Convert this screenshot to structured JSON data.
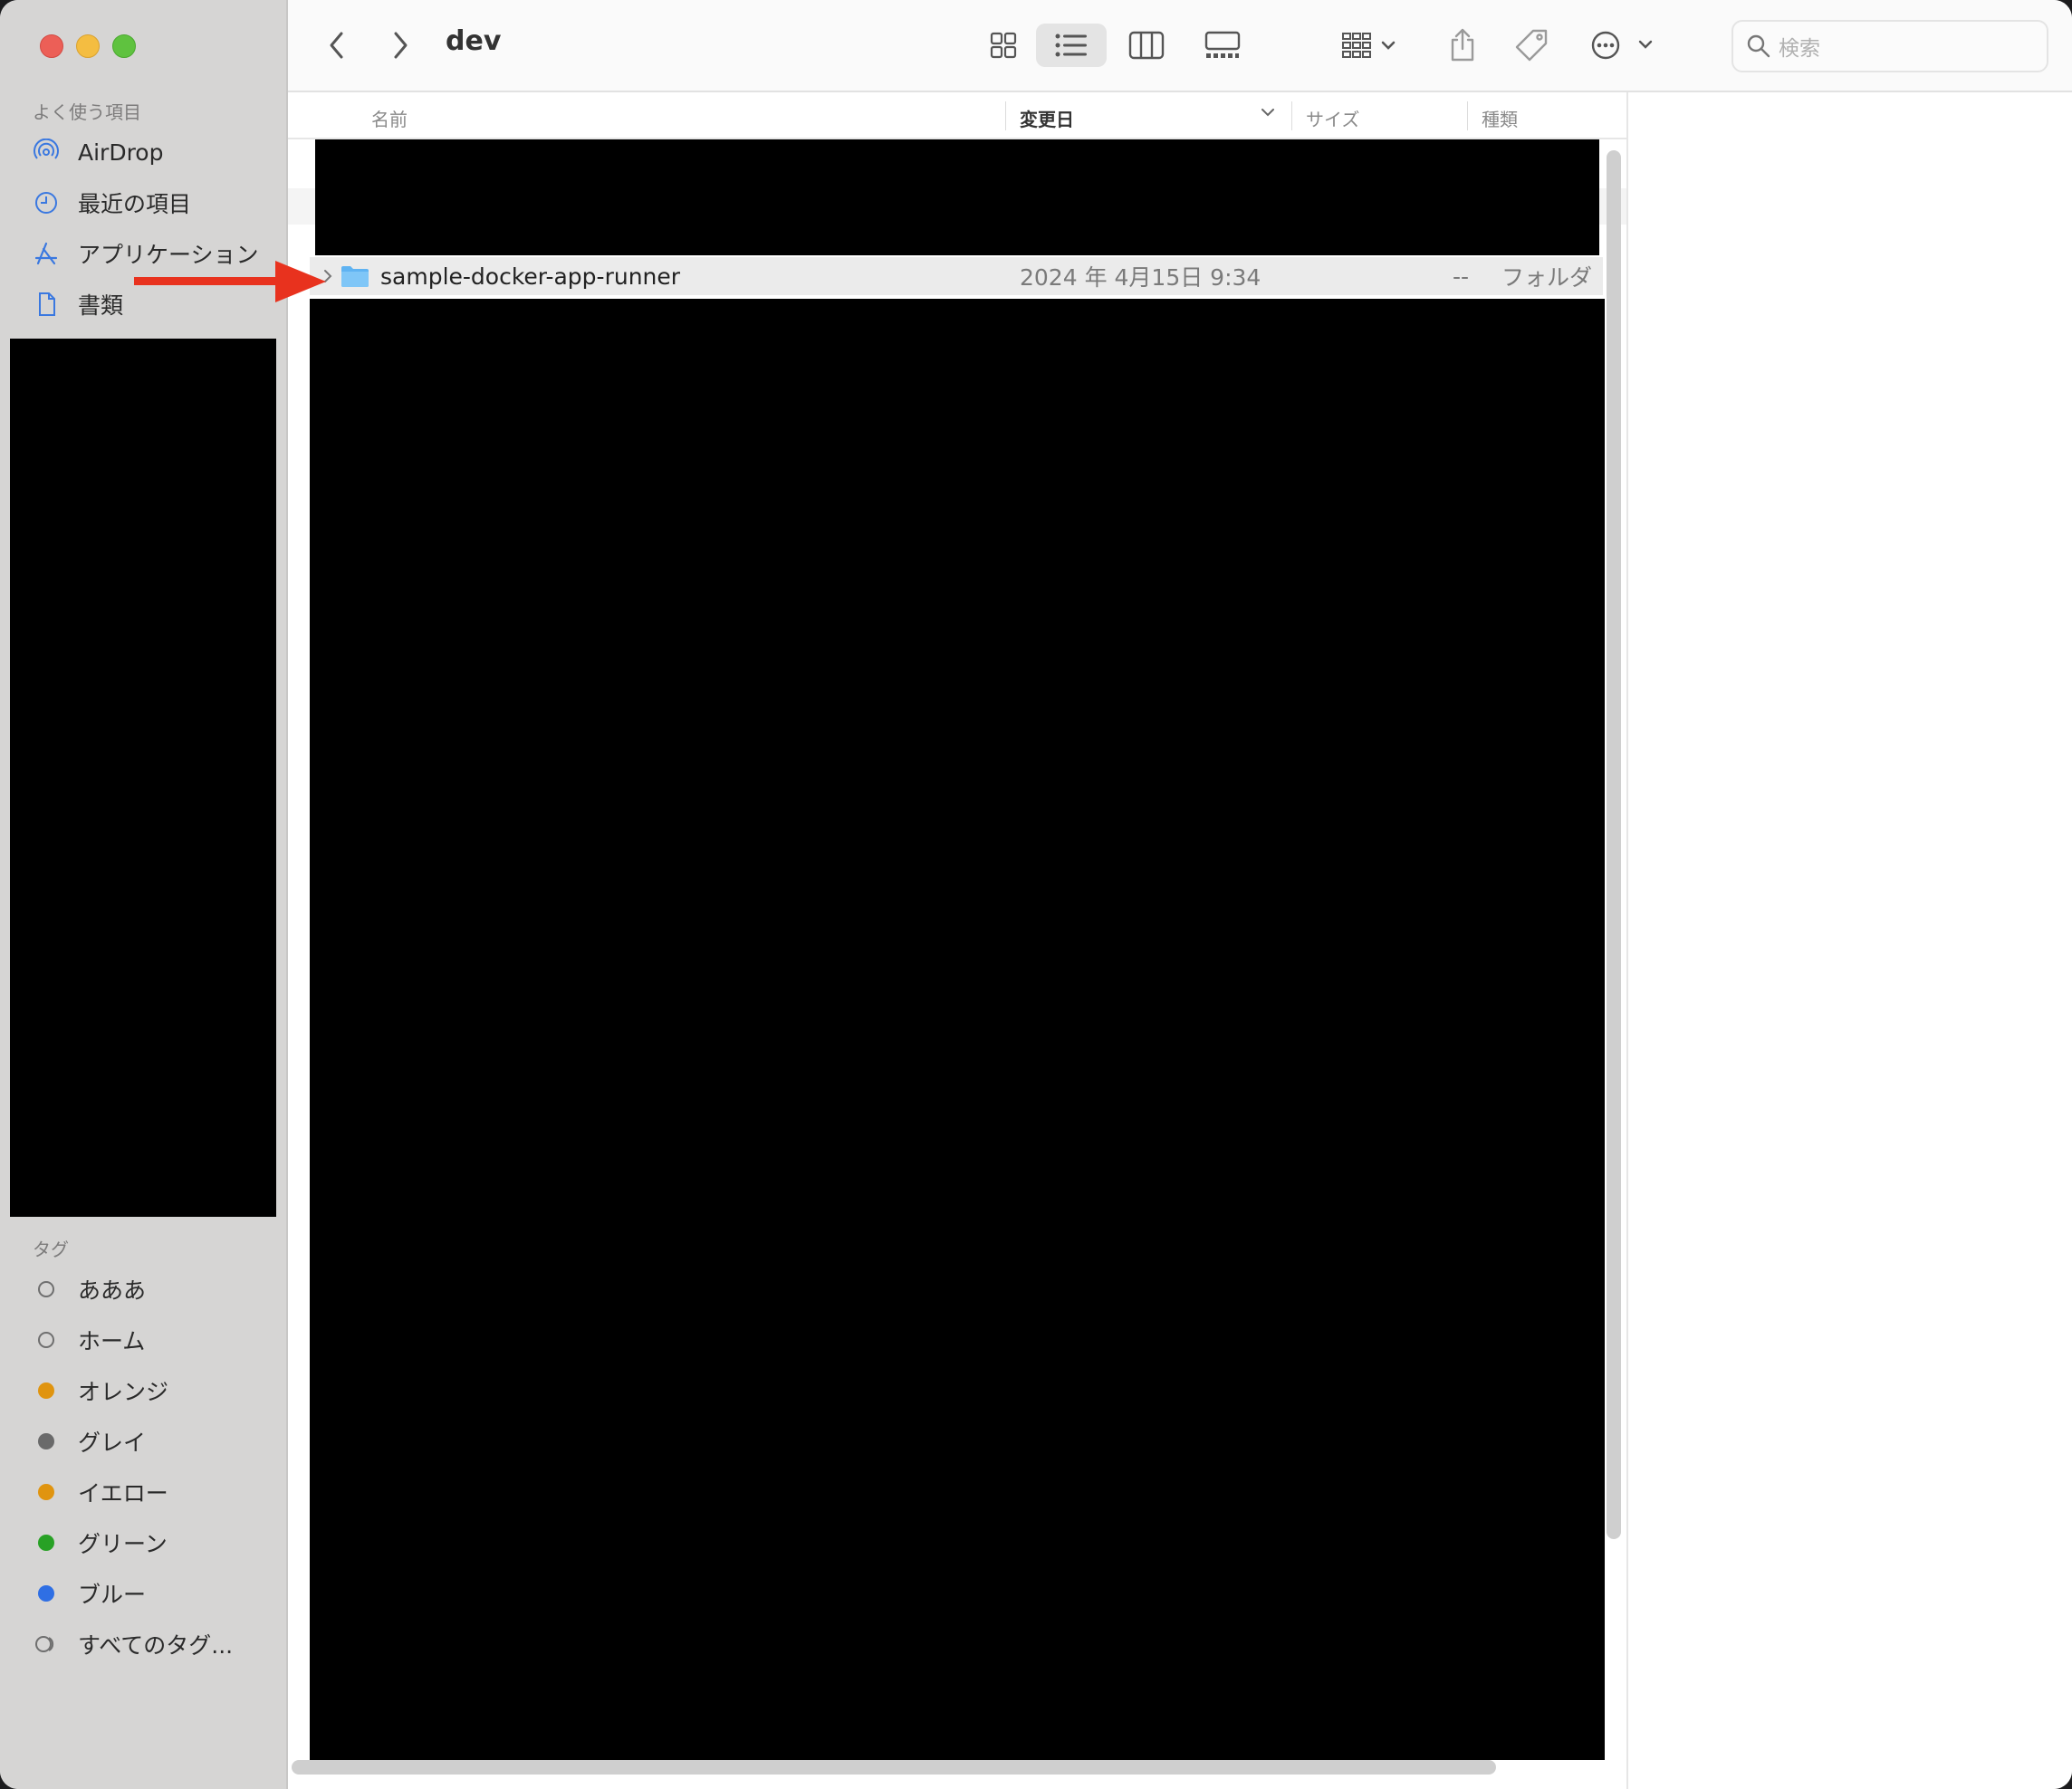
{
  "window": {
    "title": "dev"
  },
  "sidebar": {
    "favorites_heading": "よく使う項目",
    "favorites": [
      {
        "label": "AirDrop",
        "icon": "airdrop-icon"
      },
      {
        "label": "最近の項目",
        "icon": "clock-icon"
      },
      {
        "label": "アプリケーション",
        "icon": "applications-icon"
      },
      {
        "label": "書類",
        "icon": "document-icon"
      }
    ],
    "tags_heading": "タグ",
    "tags": [
      {
        "label": "あああ",
        "color": ""
      },
      {
        "label": "ホーム",
        "color": ""
      },
      {
        "label": "オレンジ",
        "color": "#e0940f"
      },
      {
        "label": "グレイ",
        "color": "#6a6a6a"
      },
      {
        "label": "イエロー",
        "color": "#e0940f"
      },
      {
        "label": "グリーン",
        "color": "#28a125"
      },
      {
        "label": "ブルー",
        "color": "#2f6fe4"
      },
      {
        "label": "すべてのタグ...",
        "color": ""
      }
    ]
  },
  "toolbar": {
    "search_placeholder": "検索",
    "icons": [
      "back-icon",
      "forward-icon",
      "icon-view-icon",
      "list-view-icon",
      "column-view-icon",
      "gallery-view-icon",
      "group-icon",
      "share-icon",
      "tag-icon",
      "more-icon",
      "search-icon"
    ]
  },
  "columns": {
    "name": "名前",
    "modified": "変更日",
    "size": "サイズ",
    "kind": "種類"
  },
  "rows": [
    {
      "name": "sample-docker-app-runner",
      "modified": "2024 年 4月15日 9:34",
      "size": "--",
      "kind": "フォルダ"
    }
  ],
  "colors": {
    "accent": "#2f6fe4",
    "annotation_arrow": "#e8321e"
  }
}
